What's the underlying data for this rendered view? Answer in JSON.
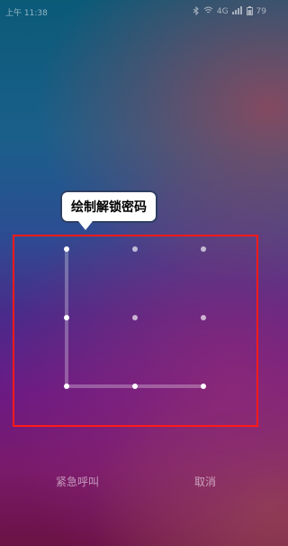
{
  "status_bar": {
    "time": "上午 11:38",
    "network": "4G",
    "battery": "79"
  },
  "tooltip": {
    "text": "绘制解锁密码"
  },
  "buttons": {
    "emergency_call": "紧急呼叫",
    "cancel": "取消"
  },
  "pattern": {
    "grid": "3x3",
    "active_sequence": [
      1,
      4,
      7,
      8,
      9
    ]
  },
  "colors": {
    "highlight": "#ff1a1a",
    "tooltip_border": "#2d3e63"
  }
}
